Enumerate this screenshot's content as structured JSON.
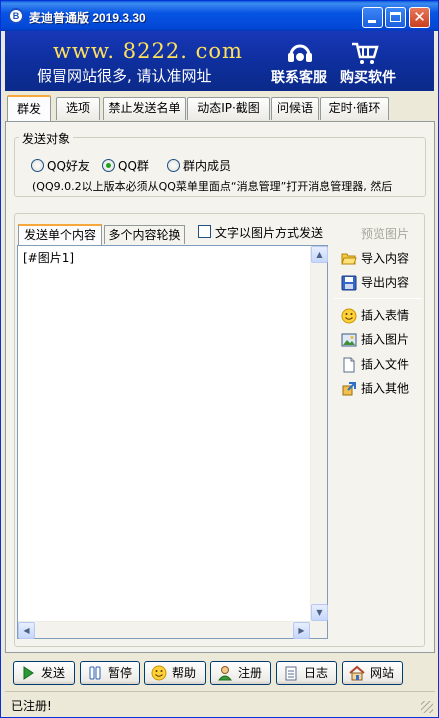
{
  "window": {
    "title": "麦迪普通版 2019.3.30",
    "app_icon_letter": "B"
  },
  "banner": {
    "url": "www. 8222. com",
    "slogan": "假冒网站很多, 请认准网址",
    "customer_service": "联系客服",
    "buy": "购买软件"
  },
  "tabs": [
    {
      "label": "群发",
      "active": true
    },
    {
      "label": "选项"
    },
    {
      "label": "禁止发送名单"
    },
    {
      "label": "动态IP·截图"
    },
    {
      "label": "问候语"
    },
    {
      "label": "定时·循环"
    }
  ],
  "target": {
    "legend": "发送对象",
    "options": [
      {
        "label": "QQ好友",
        "checked": false
      },
      {
        "label": "QQ群",
        "checked": true
      },
      {
        "label": "群内成员",
        "checked": false
      }
    ],
    "hint": "(QQ9.0.2以上版本必须从QQ菜单里面点“消息管理”打开消息管理器, 然后"
  },
  "content": {
    "subtabs": [
      "发送单个内容",
      "多个内容轮换"
    ],
    "image_checkbox_label": "文字以图片方式发送",
    "image_checkbox_checked": false,
    "preview_label": "预览图片",
    "editor_text": "[#图片1]",
    "side_actions": {
      "import": "导入内容",
      "export": "导出内容",
      "emoji": "插入表情",
      "picture": "插入图片",
      "file": "插入文件",
      "other": "插入其他"
    }
  },
  "buttons": {
    "send": "发送",
    "pause": "暂停",
    "help": "帮助",
    "register": "注册",
    "log": "日志",
    "site": "网站"
  },
  "status": {
    "text": "已注册!"
  }
}
